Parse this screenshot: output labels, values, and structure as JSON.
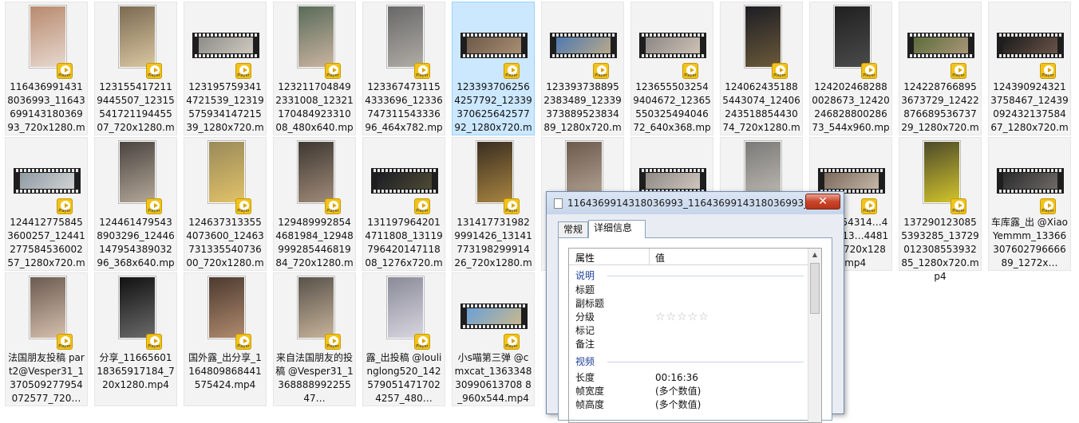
{
  "files": [
    {
      "name": "1164369914318036993_1164369914318036993_720x1280.mp4",
      "kind": "portrait",
      "c1": "#b88a6e",
      "c2": "#e7d8cf"
    },
    {
      "name": "1231554172119445507_1231554172119445507_720x1280.mp4",
      "kind": "portrait",
      "c1": "#7b6a52",
      "c2": "#d9c6a1"
    },
    {
      "name": "1231957593414721539_1231957593414721539_1280x720.mp4",
      "kind": "film",
      "c1": "#8c8c88",
      "c2": "#cfcac0"
    },
    {
      "name": "1232117048492331008_1232117048492331008_480x640.mp4",
      "kind": "portrait",
      "c1": "#5a6b5a",
      "c2": "#c9b4a0"
    },
    {
      "name": "1233674731154333696_1233674731154333696_464x782.mp4",
      "kind": "portrait",
      "c1": "#686868",
      "c2": "#b0aca6"
    },
    {
      "name": "1233937062564257792_1233937062564257792_1280x720.mp4",
      "kind": "film",
      "c1": "#6d5a4a",
      "c2": "#a88e72"
    },
    {
      "name": "1233937388952383489_1233937388952383489_1280x720.mp4",
      "kind": "film",
      "c1": "#4f79b0",
      "c2": "#b9a98a"
    },
    {
      "name": "1236555032549404672_1236555032549404672_640x368.mp4",
      "kind": "film",
      "c1": "#8b8684",
      "c2": "#cfc2b6"
    },
    {
      "name": "1240624351885443074_1240624351885443074_720x1280.mp4",
      "kind": "portrait",
      "c1": "#1d1d24",
      "c2": "#6b5a3a"
    },
    {
      "name": "1242024682880028673_1242024682880028673_544x960.mp4",
      "kind": "portrait",
      "c1": "#202020",
      "c2": "#4b4b4b"
    },
    {
      "name": "1242287668953673729_1242287668953673729_1280x720.mp4",
      "kind": "film",
      "c1": "#5d6c3c",
      "c2": "#a89676"
    },
    {
      "name": "1243909243213758467_1243909243213758467_1280x720.mp4",
      "kind": "film",
      "c1": "#1c1c1c",
      "c2": "#6a5448"
    },
    {
      "name": "1244127758453600257_1244127758453600257_1280x720.mp4",
      "kind": "film",
      "c1": "#8e9aa2",
      "c2": "#d1d3d4"
    },
    {
      "name": "1244614795438903296_1244614795438903296_368x640.mp4",
      "kind": "portrait",
      "c1": "#4a4440",
      "c2": "#b3a798"
    },
    {
      "name": "1246373133554073600_1246373133554073600_720x1280.mp4",
      "kind": "portrait",
      "c1": "#9a8a5a",
      "c2": "#e1c26a"
    },
    {
      "name": "1294899928544681984_1294899928544681984_720x1280.mp4",
      "kind": "portrait",
      "c1": "#3d3832",
      "c2": "#a08a78"
    },
    {
      "name": "1311979642014711808_1311979642014711808_1276x720.mp4",
      "kind": "film",
      "c1": "#1b1d25",
      "c2": "#4e4a34"
    },
    {
      "name": "1314177319829991426_1314177319829991426_720x1280.mp4",
      "kind": "portrait",
      "c1": "#3a2e22",
      "c2": "#a88440"
    },
    {
      "name": "",
      "kind": "portrait",
      "c1": "#6c5b4e",
      "c2": "#b8a898"
    },
    {
      "name": "",
      "kind": "film",
      "c1": "#8f8a86",
      "c2": "#cfc6bd"
    },
    {
      "name": "",
      "kind": "portrait",
      "c1": "#7a7a78",
      "c2": "#c2bdb6"
    },
    {
      "name": "…39554314…4_131913…4481664…720x1280.mp4",
      "kind": "film",
      "c1": "#7c6a5c",
      "c2": "#c4b6a6"
    },
    {
      "name": "1372901230855393285_1372901230855393285_1280x720.mp4",
      "kind": "portrait",
      "c1": "#4d4a2a",
      "c2": "#d2c42c"
    },
    {
      "name": "车库露_出 @XiaoYemmm_1336630760279666689_1272x…",
      "kind": "film",
      "c1": "#2a2a2c",
      "c2": "#6e6a66"
    },
    {
      "name": "法国朋友投稿 part2@Vesper31_1370509277954072577_720…",
      "kind": "portrait",
      "c1": "#6a5a50",
      "c2": "#d6c0ae"
    },
    {
      "name": "分享_1166560118365917184_720x1280.mp4",
      "kind": "portrait",
      "c1": "#111111",
      "c2": "#6b6b6b"
    },
    {
      "name": "国外露_出分享_1164809868441575424.mp4",
      "kind": "portrait",
      "c1": "#4c3a30",
      "c2": "#b08a6e"
    },
    {
      "name": "来自法国朋友的投稿 @Vesper31_136888899225547…",
      "kind": "portrait",
      "c1": "#58524a",
      "c2": "#c7b39a"
    },
    {
      "name": "露_出投稿 @loulinglong520_1425790514717024257_480…",
      "kind": "portrait",
      "c1": "#8a8a98",
      "c2": "#d8d6e0"
    },
    {
      "name": "小s喵第三弹 @cmxcat_136334830990613708 8_960x544.mp4",
      "kind": "film",
      "c1": "#6aa0d6",
      "c2": "#c8b88e"
    }
  ],
  "badge_label": "Player",
  "dialog": {
    "title": "1164369914318036993_1164369914318036993_...",
    "close": "✕",
    "tabs": [
      "常规",
      "详细信息"
    ],
    "col_property": "属性",
    "col_value": "值",
    "section_desc": "说明",
    "rows_desc": [
      "标题",
      "副标题",
      "分级",
      "标记",
      "备注"
    ],
    "rating_stars": "☆☆☆☆☆",
    "section_video": "视频",
    "rows_video": [
      "长度",
      "帧宽度",
      "帧高度"
    ],
    "val_length": "00:16:36",
    "val_width": "(多个数值)",
    "val_height": "(多个数值)"
  }
}
